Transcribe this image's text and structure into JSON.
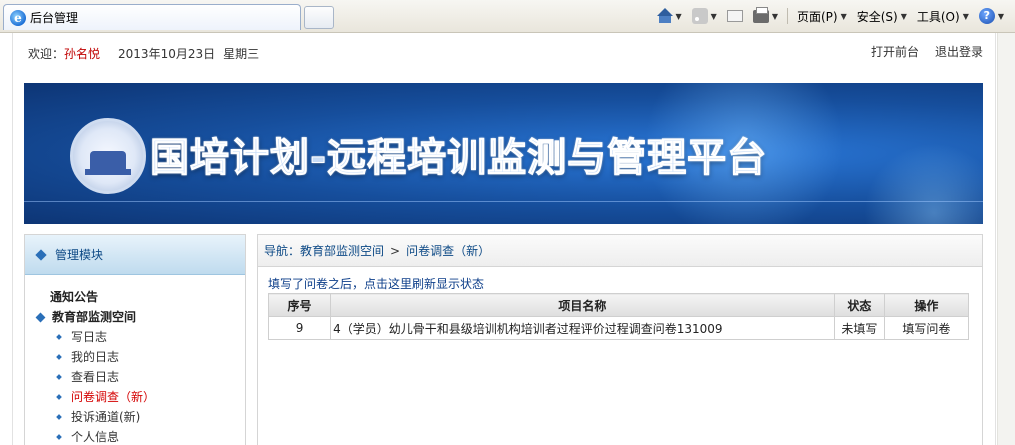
{
  "browser": {
    "tab_title": "后台管理",
    "toolbar": {
      "page_label": "页面(P)",
      "safety_label": "安全(S)",
      "tools_label": "工具(O)",
      "help_glyph": "?"
    }
  },
  "header": {
    "welcome_label": "欢迎：",
    "username": "孙名悦",
    "date": "2013年10月23日",
    "weekday": "星期三",
    "open_front_label": "打开前台",
    "logout_label": "退出登录"
  },
  "banner": {
    "title": "国培计划-远程培训监测与管理平台"
  },
  "sidebar": {
    "title": "管理模块",
    "sections": [
      {
        "label": "通知公告"
      },
      {
        "label": "教育部监测空间"
      }
    ],
    "items": [
      {
        "label": "写日志"
      },
      {
        "label": "我的日志"
      },
      {
        "label": "查看日志"
      },
      {
        "label": "问卷调查（新）"
      },
      {
        "label": "投诉通道(新)"
      },
      {
        "label": "个人信息"
      }
    ]
  },
  "main": {
    "nav_prefix": "导航：",
    "nav_parent": "教育部监测空间",
    "nav_arrow": ">",
    "nav_current": "问卷调查（新）",
    "refresh_text": "填写了问卷之后，点击这里刷新显示状态",
    "table": {
      "headers": [
        "序号",
        "项目名称",
        "状态",
        "操作"
      ],
      "rows": [
        {
          "no": "9",
          "name": "4（学员）幼儿骨干和县级培训机构培训者过程评价过程调查问卷131009",
          "status": "未填写",
          "action": "填写问卷"
        }
      ]
    }
  },
  "colors": {
    "accent": "#2a6fb8",
    "username": "#c00000",
    "active_item": "#d40000",
    "banner_blue": "#164e9c"
  }
}
